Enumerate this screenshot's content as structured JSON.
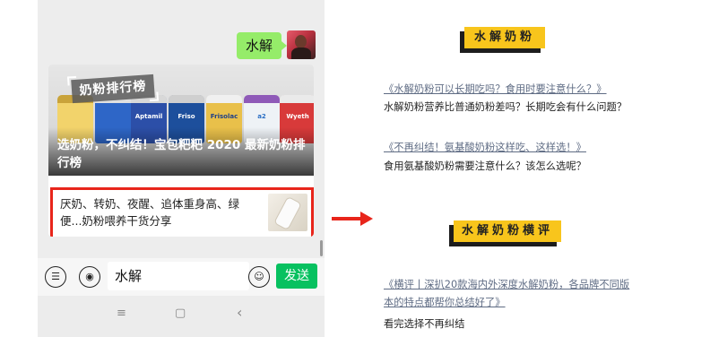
{
  "chat": {
    "sent_message": "水解",
    "card": {
      "banner_tag": "奶粉排行榜",
      "product_labels": [
        "Aptamil",
        "Friso",
        "Frisolac",
        "a2",
        "Wyeth"
      ],
      "banner_title": "选奶粉，不纠结！宝包粑粑 2020 最新奶粉排行榜",
      "highlighted_item": "厌奶、转奶、夜醒、追体重身高、绿便...奶粉喂养干货分享"
    },
    "input_value": "水解",
    "send_label": "发送",
    "icons": {
      "list": "list-icon",
      "voice": "voice-icon",
      "emoji": "emoji-icon"
    },
    "nav": {
      "menu": "≡",
      "home": "▢",
      "back": "‹"
    }
  },
  "article": {
    "section1": {
      "heading": "水解奶粉",
      "entries": [
        {
          "link": "《水解奶粉可以长期吃吗？食用时要注意什么？》",
          "desc": "水解奶粉营养比普通奶粉差吗？长期吃会有什么问题？"
        },
        {
          "link": "《不再纠结！氨基酸奶粉这样吃、这样选！》",
          "desc": "食用氨基酸奶粉需要注意什么？该怎么选呢？"
        }
      ]
    },
    "section2": {
      "heading": "水解奶粉横评",
      "entries": [
        {
          "link_line1": "《横评丨深扒20款海内外深度水解奶粉，各品牌不同版",
          "link_line2": "本的特点都帮你总结好了》",
          "desc": "看完选择不再纠结"
        }
      ]
    }
  },
  "colors": {
    "accent_green": "#07c160",
    "bubble_green": "#95ec69",
    "highlight_red": "#e8251b",
    "heading_yellow": "#f8c51c"
  }
}
